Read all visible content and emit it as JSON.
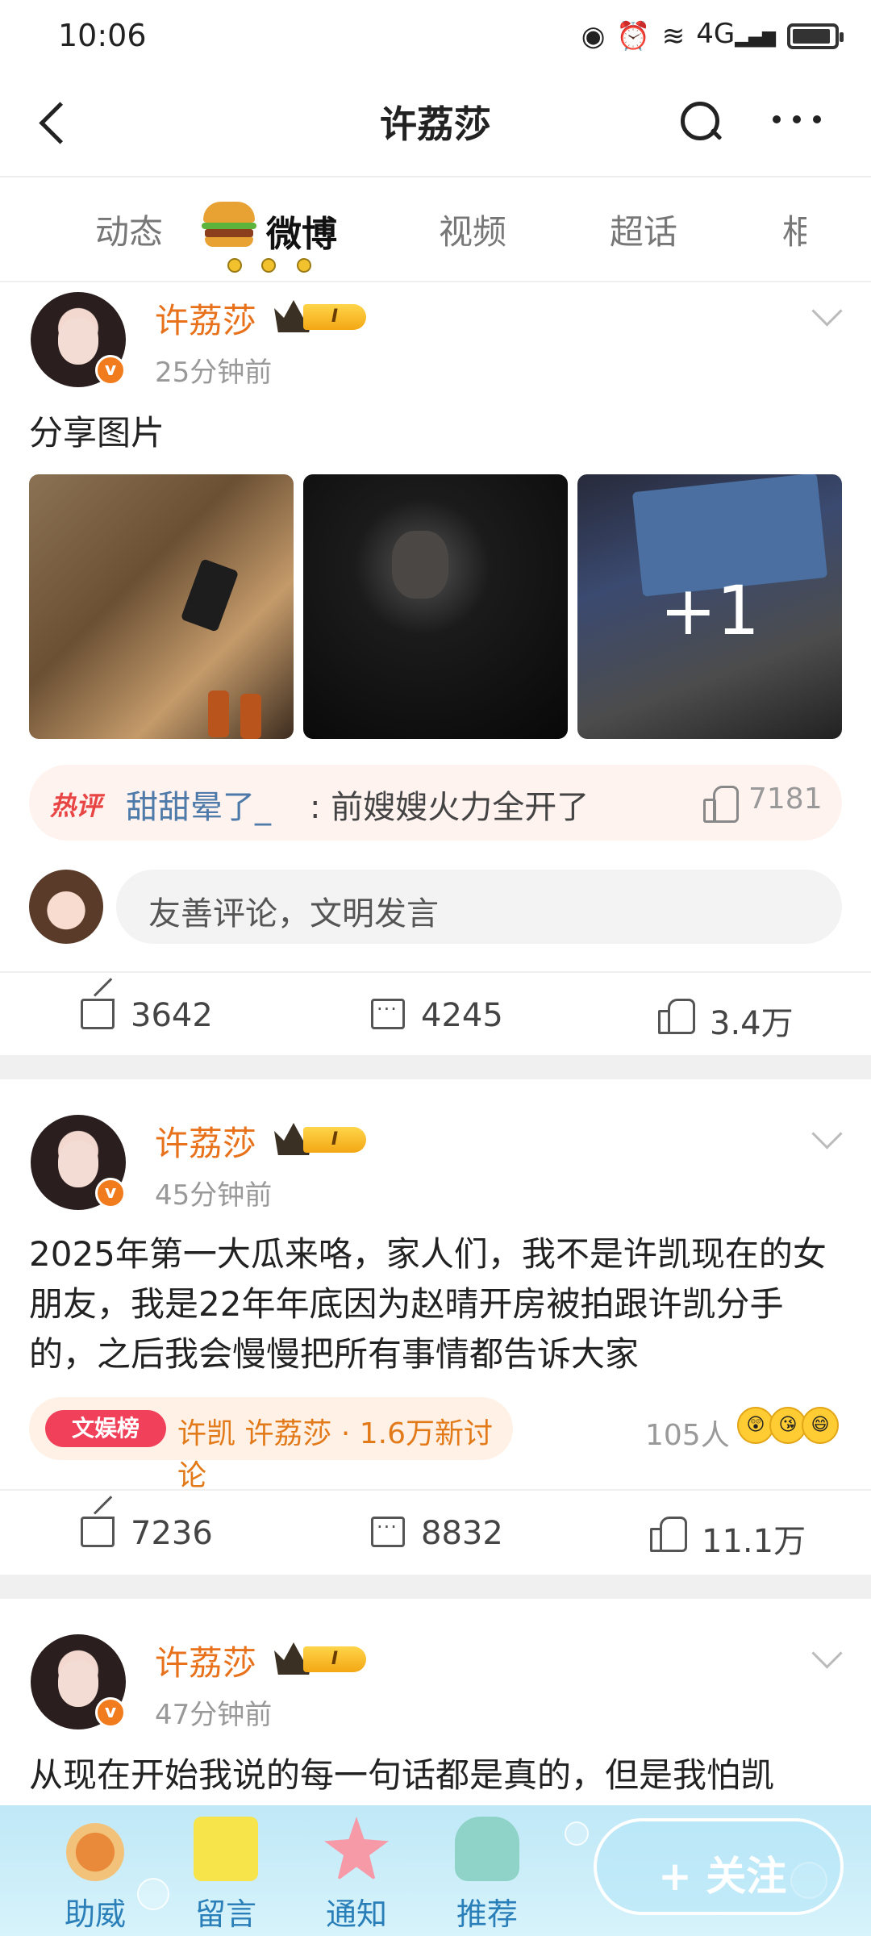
{
  "status_bar": {
    "time": "10:06",
    "network": "4G"
  },
  "header": {
    "title": "许荔莎"
  },
  "tabs": [
    {
      "label": "动态"
    },
    {
      "label": "微博",
      "active": true
    },
    {
      "label": "视频"
    },
    {
      "label": "超话"
    },
    {
      "label": "相"
    }
  ],
  "posts": [
    {
      "user": "许荔莎",
      "level": "I",
      "verified_mark": "v",
      "time": "25分钟前",
      "text": "分享图片",
      "more_photos": "+1",
      "hot_comment": {
        "label": "热评",
        "user": "甜甜晕了_",
        "text": ":  前嫂嫂火力全开了",
        "likes": "7181"
      },
      "comment_placeholder": "友善评论，文明发言",
      "reposts": "3642",
      "comments": "4245",
      "likes": "3.4万"
    },
    {
      "user": "许荔莎",
      "level": "I",
      "verified_mark": "v",
      "time": "45分钟前",
      "text": "2025年第一大瓜来咯，家人们，我不是许凯现在的女朋友，我是22年年底因为赵晴开房被拍跟许凯分手的，之后我会慢慢把所有事情都告诉大家",
      "topic_badge": "文娱榜",
      "topic_text": "许凯 许荔莎 · 1.6万新讨论",
      "people": "105人",
      "reposts": "7236",
      "comments": "8832",
      "likes": "11.1万"
    },
    {
      "user": "许荔莎",
      "level": "I",
      "verified_mark": "v",
      "time": "47分钟前",
      "text": "从现在开始我说的每一句话都是真的，但是我怕凯"
    }
  ],
  "bottom_bar": {
    "items": [
      {
        "label": "助威"
      },
      {
        "label": "留言"
      },
      {
        "label": "通知"
      },
      {
        "label": "推荐"
      }
    ],
    "follow_label": "+ 关注"
  },
  "colors": {
    "accent": "#e8711b",
    "link": "#4d7aa8",
    "hot": "#e84545",
    "bottom_bar": "#c8ecf8"
  }
}
